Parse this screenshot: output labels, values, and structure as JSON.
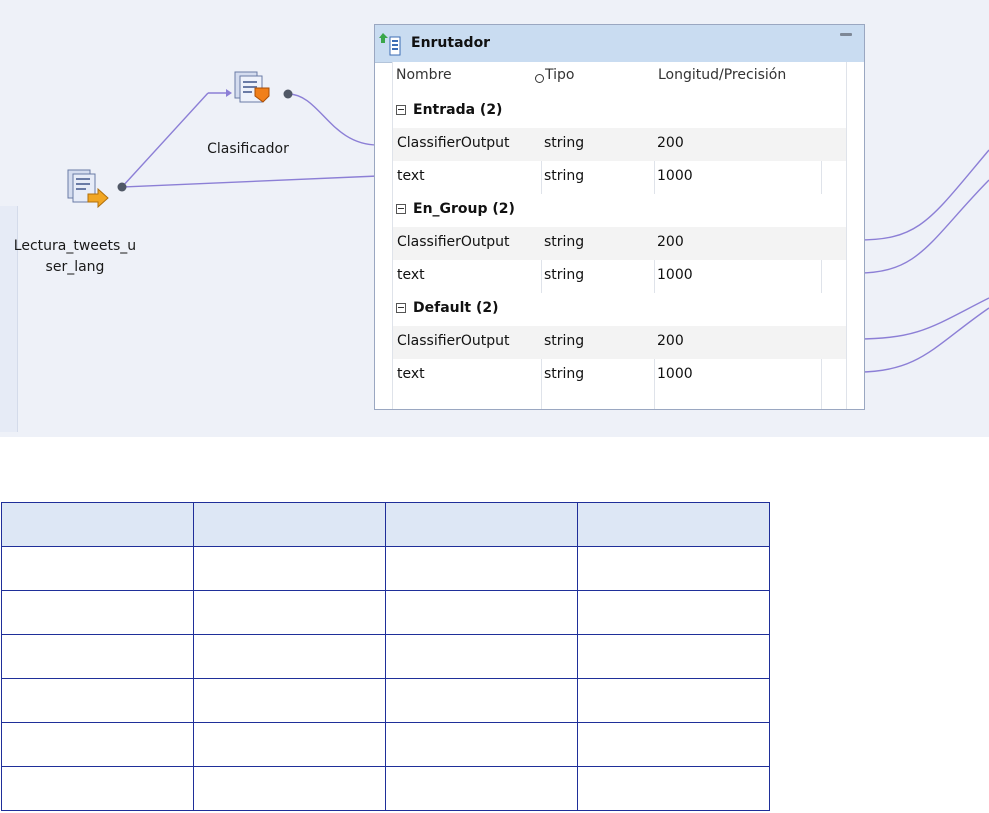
{
  "canvas": {
    "source_node_label": "Lectura_tweets_u ser_lang",
    "classifier_node_label": "Clasificador"
  },
  "router": {
    "title": "Enrutador",
    "columns": [
      "Nombre",
      "Tipo",
      "Longitud/Precisión"
    ],
    "groups": [
      {
        "label": "Entrada (2)",
        "rows": [
          {
            "name": "ClassifierOutput",
            "type": "string",
            "length": "200"
          },
          {
            "name": "text",
            "type": "string",
            "length": "1000"
          }
        ]
      },
      {
        "label": "En_Group (2)",
        "rows": [
          {
            "name": "ClassifierOutput",
            "type": "string",
            "length": "200"
          },
          {
            "name": "text",
            "type": "string",
            "length": "1000"
          }
        ]
      },
      {
        "label": "Default (2)",
        "rows": [
          {
            "name": "ClassifierOutput",
            "type": "string",
            "length": "200"
          },
          {
            "name": "text",
            "type": "string",
            "length": "1000"
          }
        ]
      }
    ]
  },
  "colors": {
    "wire": "#8c7fd6",
    "table_border": "#1f2f99",
    "table_header": "#dde7f5",
    "router_title_bg": "#c9dcf1"
  },
  "icons": [
    "router-icon",
    "source-icon",
    "classifier-icon",
    "minimize-icon",
    "collapse-icon"
  ]
}
